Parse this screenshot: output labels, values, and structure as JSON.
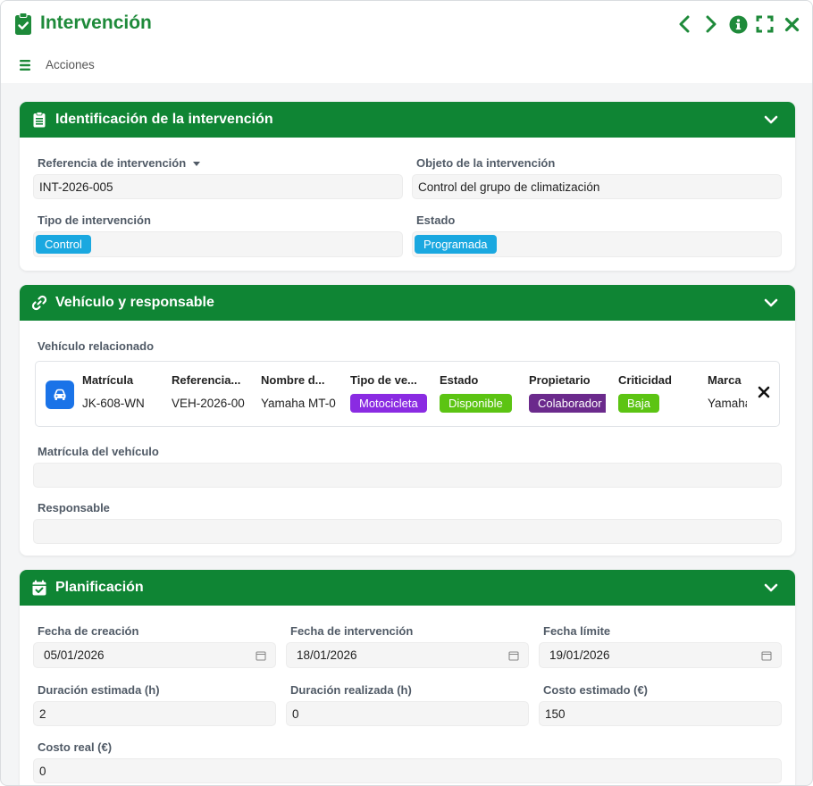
{
  "window": {
    "title": "Intervención",
    "menu_label": "Acciones"
  },
  "colors": {
    "brand_green": "#0f8534",
    "title_green": "#1e8a3a",
    "tag_blue": "#1aa8e0",
    "tag_purple": "#8a2be2",
    "tag_green": "#5cc413",
    "tag_darkpurple": "#6b2a8c"
  },
  "icons": {
    "title": "clipboard-check-icon",
    "prev": "chevron-left-icon",
    "next": "chevron-right-icon",
    "info": "info-circle-icon",
    "expand": "expand-icon",
    "close": "close-icon",
    "menu": "hamburger-menu-icon"
  },
  "identificacion": {
    "title": "Identificación de la intervención",
    "icon": "clipboard-list-icon",
    "referencia": {
      "label": "Referencia de intervención",
      "value": "INT-2026-005"
    },
    "objeto": {
      "label": "Objeto de la intervención",
      "value": "Control del grupo de climatización"
    },
    "tipo": {
      "label": "Tipo de intervención",
      "tag": "Control"
    },
    "estado": {
      "label": "Estado",
      "tag": "Programada"
    }
  },
  "vehiculo": {
    "title": "Vehículo y responsable",
    "icon": "link-icon",
    "relacionado_label": "Vehículo relacionado",
    "columns": [
      {
        "header": "Matrícula",
        "value": "JK-608-WN"
      },
      {
        "header": "Referencia...",
        "value": "VEH-2026-00"
      },
      {
        "header": "Nombre d...",
        "value": "Yamaha MT-0"
      },
      {
        "header": "Tipo de ve...",
        "tag": "Motocicleta"
      },
      {
        "header": "Estado",
        "tag": "Disponible"
      },
      {
        "header": "Propietario",
        "tag": "Colaborador"
      },
      {
        "header": "Criticidad",
        "tag": "Baja"
      },
      {
        "header": "Marca",
        "value": "Yamaha"
      }
    ],
    "matricula_label": "Matrícula del vehículo",
    "matricula_value": "",
    "responsable_label": "Responsable",
    "responsable_value": ""
  },
  "planificacion": {
    "title": "Planificación",
    "icon": "calendar-check-icon",
    "fecha_creacion": {
      "label": "Fecha de creación",
      "value": "05/01/2026"
    },
    "fecha_intervencion": {
      "label": "Fecha de intervención",
      "value": "18/01/2026"
    },
    "fecha_limite": {
      "label": "Fecha límite",
      "value": "19/01/2026"
    },
    "duracion_estimada": {
      "label": "Duración estimada (h)",
      "value": "2"
    },
    "duracion_realizada": {
      "label": "Duración realizada (h)",
      "value": "0"
    },
    "costo_estimado": {
      "label": "Costo estimado (€)",
      "value": "150"
    },
    "costo_real": {
      "label": "Costo real (€)",
      "value": "0"
    }
  }
}
